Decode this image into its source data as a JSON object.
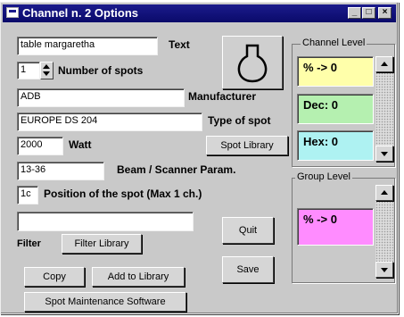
{
  "window": {
    "title": "Channel n. 2 Options",
    "minimize_glyph": "_",
    "maximize_glyph": "□",
    "close_glyph": "×"
  },
  "fields": {
    "text": {
      "value": "table margaretha",
      "label": "Text"
    },
    "spots": {
      "value": "1",
      "label": "Number of spots"
    },
    "manufacturer": {
      "value": "ADB",
      "label": "Manufacturer"
    },
    "spot_type": {
      "value": "EUROPE DS 204",
      "label": "Type of spot"
    },
    "watt": {
      "value": "2000",
      "label": "Watt"
    },
    "beam": {
      "value": "13-36",
      "label": "Beam / Scanner Param."
    },
    "position": {
      "value": "1c",
      "label": "Position of the spot (Max 1 ch.)"
    },
    "filter": {
      "value": "",
      "label": "Filter"
    }
  },
  "buttons": {
    "spot_library": "Spot Library",
    "filter_library": "Filter Library",
    "quit": "Quit",
    "save": "Save",
    "copy": "Copy",
    "add_to_library": "Add to Library",
    "maintenance": "Spot Maintenance Software"
  },
  "channel_level": {
    "title": "Channel Level",
    "percent": "% -> 0",
    "dec": "Dec: 0",
    "hex": "Hex: 0"
  },
  "group_level": {
    "title": "Group Level",
    "percent": "% -> 0"
  },
  "icons": {
    "spot_lamp": "spot-lamp-icon"
  },
  "colors": {
    "titlebar": "#0a0a6a",
    "percent_bg": "#ffffaa",
    "dec_bg": "#b5f0b0",
    "hex_bg": "#aef2f2",
    "group_bg": "#ff8cff"
  }
}
